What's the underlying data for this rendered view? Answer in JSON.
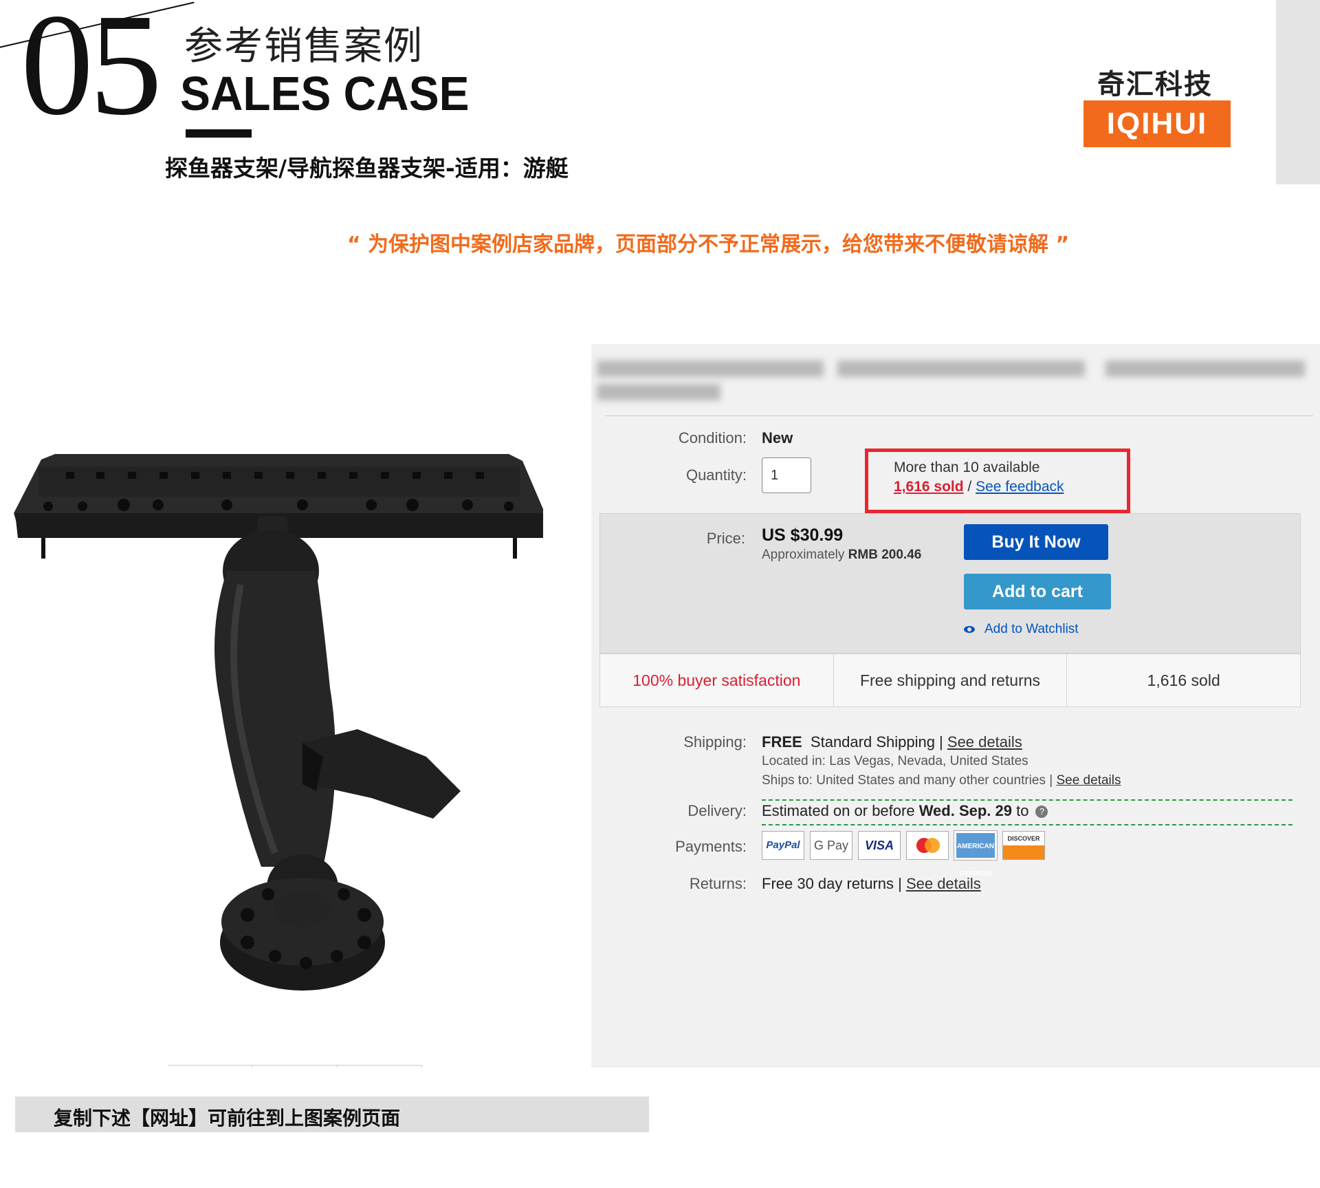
{
  "header": {
    "number": "05",
    "cn_title": "参考销售案例",
    "en_title": "SALES CASE",
    "subtitle": "探鱼器支架/导航探鱼器支架-适用：游艇",
    "brand_cn": "奇汇科技",
    "brand_en": "IQIHUI",
    "brand_color": "#f26a1b"
  },
  "notice": "“ 为保护图中案例店家品牌，页面部分不予正常展示，给您带来不便敬请谅解 ”",
  "product_image": {
    "icon": "fishfinder-mount-photo"
  },
  "listing": {
    "condition_label": "Condition:",
    "condition_value": "New",
    "quantity_label": "Quantity:",
    "quantity_value": "1",
    "availability": "More than 10 available",
    "sold_link": "1,616 sold",
    "separator": " / ",
    "feedback_link": "See feedback",
    "price_label": "Price:",
    "price_value": "US $30.99",
    "approx_prefix": "Approximately ",
    "approx_value": "RMB 200.46",
    "buy_now": "Buy It Now",
    "add_to_cart": "Add to cart",
    "watchlist": "Add to Watchlist",
    "stats": [
      "100% buyer satisfaction",
      "Free shipping and returns",
      "1,616 sold"
    ],
    "shipping_label": "Shipping:",
    "shipping_free": "FREE",
    "shipping_method": "Standard Shipping | ",
    "shipping_details": "See details",
    "located_label": "Located in: ",
    "located_value": "Las Vegas, Nevada, United States",
    "ships_to_label": "Ships to: ",
    "ships_to_value": "United States and many other countries | ",
    "ships_to_details": "See details",
    "delivery_label": "Delivery:",
    "delivery_prefix": "Estimated on or before ",
    "delivery_date": "Wed. Sep. 29",
    "delivery_suffix": " to",
    "payments_label": "Payments:",
    "payments": [
      "PayPal",
      "G Pay",
      "VISA",
      "",
      "AMERICAN EXPRESS",
      "DISCOVER"
    ],
    "returns_label": "Returns:",
    "returns_value": "Free 30 day returns | ",
    "returns_details": "See details",
    "colors": {
      "buy": "#0654ba",
      "cart": "#3498ca",
      "sold_red": "#dd1e31",
      "box_red": "#e8262e"
    }
  },
  "footer": "复制下述【网址】可前往到上图案例页面"
}
